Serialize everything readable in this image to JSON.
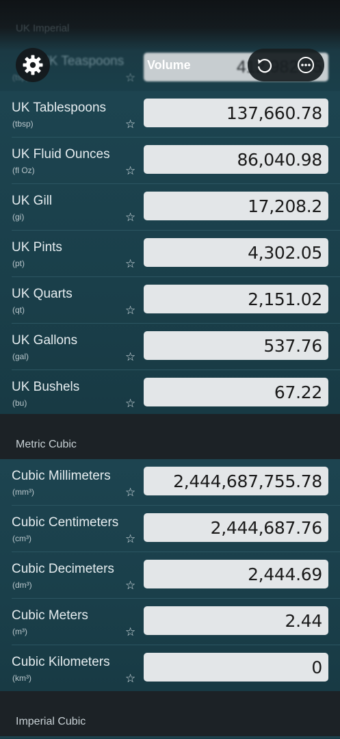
{
  "top": {
    "ghost_section": "UK Imperial",
    "ghost_row_name": "UK Teaspoons",
    "ghost_row_abbr": "(tsp)",
    "ghost_row_value": "412,982.35",
    "title": "Volume",
    "icons": [
      "gear-icon",
      "undo-icon",
      "more-icon"
    ]
  },
  "uk_imperial": {
    "rows": [
      {
        "name": "UK Tablespoons",
        "abbr": "(tbsp)",
        "value": "137,660.78"
      },
      {
        "name": "UK Fluid Ounces",
        "abbr": "(fl Oz)",
        "value": "86,040.98"
      },
      {
        "name": "UK Gill",
        "abbr": "(gi)",
        "value": "17,208.2"
      },
      {
        "name": "UK Pints",
        "abbr": "(pt)",
        "value": "4,302.05"
      },
      {
        "name": "UK Quarts",
        "abbr": "(qt)",
        "value": "2,151.02"
      },
      {
        "name": "UK Gallons",
        "abbr": "(gal)",
        "value": "537.76"
      },
      {
        "name": "UK Bushels",
        "abbr": "(bu)",
        "value": "67.22"
      }
    ]
  },
  "metric_cubic": {
    "title": "Metric Cubic",
    "rows": [
      {
        "name": "Cubic Millimeters",
        "abbr": "(mm³)",
        "value": "2,444,687,755.78"
      },
      {
        "name": "Cubic Centimeters",
        "abbr": "(cm³)",
        "value": "2,444,687.76"
      },
      {
        "name": "Cubic Decimeters",
        "abbr": "(dm³)",
        "value": "2,444.69"
      },
      {
        "name": "Cubic Meters",
        "abbr": "(m³)",
        "value": "2.44"
      },
      {
        "name": "Cubic Kilometers",
        "abbr": "(km³)",
        "value": "0"
      }
    ]
  },
  "imperial_cubic": {
    "title": "Imperial Cubic"
  },
  "star_glyph": "☆"
}
